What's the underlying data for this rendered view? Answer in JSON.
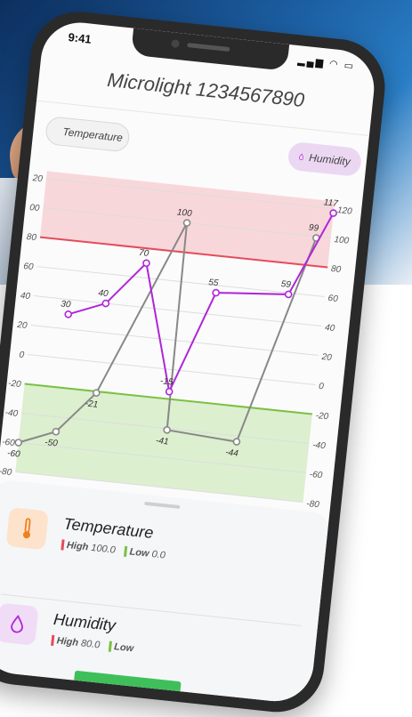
{
  "status": {
    "time": "9:41",
    "icons": "▂▄▆ ◠ ▭"
  },
  "header": {
    "title": "Microlight 1234567890"
  },
  "chips": {
    "temperature": {
      "label": "Temperature",
      "icon": "thermometer-icon"
    },
    "humidity": {
      "label": "Humidity",
      "icon": "droplet-icon"
    }
  },
  "colors": {
    "temperature_line": "#888888",
    "humidity_line": "#b025d8",
    "high_limit": "#e64b5a",
    "high_zone": "#f8d7db",
    "low_limit": "#7ac143",
    "low_zone": "#dcefcf",
    "temp_icon_bg": "#fde3cc",
    "temp_icon": "#f07f1e",
    "hum_icon_bg": "#f1dcf7",
    "hum_icon": "#b025d8"
  },
  "chart_data": {
    "type": "line",
    "x": [
      0,
      1,
      2,
      3,
      4,
      5,
      6,
      7,
      8
    ],
    "series": [
      {
        "name": "Temperature",
        "values": [
          -60,
          -50,
          -21,
          100,
          -41,
          -44,
          99
        ],
        "x": [
          0,
          1,
          2,
          4,
          4.05,
          6,
          7.6
        ]
      },
      {
        "name": "Humidity",
        "values": [
          30,
          40,
          70,
          -15,
          55,
          59,
          117
        ],
        "x": [
          1,
          2,
          3,
          4,
          5,
          7,
          8
        ]
      }
    ],
    "left_axis": {
      "ticks": [
        120,
        100,
        80,
        60,
        40,
        20,
        0,
        -20,
        -40,
        -60,
        -80
      ],
      "tick_labels": [
        "20",
        "00",
        "80",
        "60",
        "40",
        "20",
        "0",
        "-20",
        "-40",
        "-60",
        "-80"
      ]
    },
    "right_axis": {
      "ticks": [
        120,
        100,
        80,
        60,
        40,
        20,
        0,
        -20,
        -40,
        -60,
        -80
      ],
      "tick_labels": [
        "120",
        "100",
        "80",
        "60",
        "40",
        "20",
        "0",
        "-20",
        "-40",
        "-60",
        "-80"
      ]
    },
    "ylim": [
      -80,
      125
    ],
    "high_limit": 80,
    "low_limit": -20,
    "grid": true
  },
  "sensors": [
    {
      "name": "Temperature",
      "icon": "thermometer-icon",
      "high_label": "High",
      "high_value": "100.0",
      "low_label": "Low",
      "low_value": "0.0"
    },
    {
      "name": "Humidity",
      "icon": "droplet-icon",
      "high_label": "High",
      "high_value": "80.0",
      "low_label": "Low",
      "low_value": ""
    }
  ]
}
